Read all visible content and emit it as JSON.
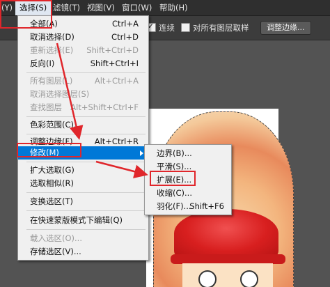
{
  "menubar": {
    "items": [
      {
        "label": "(Y)"
      },
      {
        "label": "选择(S)",
        "active": true
      },
      {
        "label": "滤镜(T)"
      },
      {
        "label": "视图(V)"
      },
      {
        "label": "窗口(W)"
      },
      {
        "label": "帮助(H)"
      }
    ]
  },
  "options": {
    "connect_label": "连续",
    "connect_checked": true,
    "sample_all_label": "对所有图层取样",
    "sample_all_checked": false,
    "refine_edge_button": "调整边缘..."
  },
  "select_menu": {
    "items": [
      {
        "label": "全部(A)",
        "shortcut": "Ctrl+A",
        "enabled": true
      },
      {
        "label": "取消选择(D)",
        "shortcut": "Ctrl+D",
        "enabled": true
      },
      {
        "label": "重新选择(E)",
        "shortcut": "Shift+Ctrl+D",
        "enabled": false
      },
      {
        "label": "反向(I)",
        "shortcut": "Shift+Ctrl+I",
        "enabled": true
      },
      {
        "label": "所有图层(L)",
        "shortcut": "Alt+Ctrl+A",
        "enabled": false
      },
      {
        "label": "取消选择图层(S)",
        "shortcut": "",
        "enabled": false
      },
      {
        "label": "查找图层",
        "shortcut": "Alt+Shift+Ctrl+F",
        "enabled": false
      },
      {
        "label": "色彩范围(C)...",
        "shortcut": "",
        "enabled": true
      },
      {
        "label": "调整边缘(F)...",
        "shortcut": "Alt+Ctrl+R",
        "enabled": true
      },
      {
        "label": "修改(M)",
        "shortcut": "",
        "enabled": true,
        "highlighted": true,
        "has_submenu": true
      },
      {
        "label": "扩大选取(G)",
        "shortcut": "",
        "enabled": true
      },
      {
        "label": "选取相似(R)",
        "shortcut": "",
        "enabled": true
      },
      {
        "label": "变换选区(T)",
        "shortcut": "",
        "enabled": true
      },
      {
        "label": "在快速蒙版模式下编辑(Q)",
        "shortcut": "",
        "enabled": true
      },
      {
        "label": "载入选区(O)...",
        "shortcut": "",
        "enabled": false
      },
      {
        "label": "存储选区(V)...",
        "shortcut": "",
        "enabled": true
      }
    ]
  },
  "modify_submenu": {
    "items": [
      {
        "label": "边界(B)...",
        "shortcut": ""
      },
      {
        "label": "平滑(S)...",
        "shortcut": ""
      },
      {
        "label": "扩展(E)...",
        "shortcut": ""
      },
      {
        "label": "收缩(C)...",
        "shortcut": ""
      },
      {
        "label": "羽化(F)...",
        "shortcut": "Shift+F6"
      }
    ]
  },
  "colors": {
    "highlight": "#0078d7",
    "annotation_red": "#e0262b",
    "menubar_bg": "#2f2f2f",
    "menu_bg": "#f0f0f0"
  }
}
